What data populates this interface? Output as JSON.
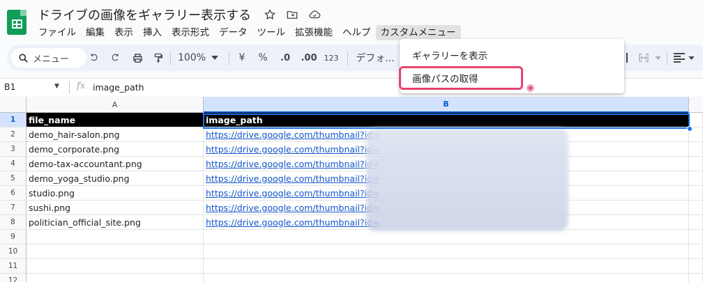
{
  "document": {
    "title": "ドライブの画像をギャラリー表示する"
  },
  "menu": {
    "items": [
      "ファイル",
      "編集",
      "表示",
      "挿入",
      "表示形式",
      "データ",
      "ツール",
      "拡張機能",
      "ヘルプ",
      "カスタムメニュー"
    ],
    "active_index": 9
  },
  "toolbar": {
    "search_label": "メニュー",
    "zoom": "100%",
    "currency": "¥",
    "percent": "%",
    "decimal_decrease": ".0",
    "decimal_increase": ".00",
    "number_format": "123",
    "font": "デフォ..."
  },
  "formula_bar": {
    "cell_ref": "B1",
    "fx": "fx",
    "value": "image_path"
  },
  "grid": {
    "columns": [
      "A",
      "B"
    ],
    "rows": [
      {
        "num": "1",
        "a": "file_name",
        "b": "image_path"
      },
      {
        "num": "2",
        "a": "demo_hair-salon.png",
        "b": "https://drive.google.com/thumbnail?id="
      },
      {
        "num": "3",
        "a": "demo_corporate.png",
        "b": "https://drive.google.com/thumbnail?id="
      },
      {
        "num": "4",
        "a": "demo-tax-accountant.png",
        "b": "https://drive.google.com/thumbnail?id="
      },
      {
        "num": "5",
        "a": "demo_yoga_studio.png",
        "b": "https://drive.google.com/thumbnail?id="
      },
      {
        "num": "6",
        "a": "studio.png",
        "b": "https://drive.google.com/thumbnail?id="
      },
      {
        "num": "7",
        "a": "sushi.png",
        "b": "https://drive.google.com/thumbnail?id="
      },
      {
        "num": "8",
        "a": "politician_official_site.png",
        "b": "https://drive.google.com/thumbnail?id="
      },
      {
        "num": "9",
        "a": "",
        "b": ""
      },
      {
        "num": "10",
        "a": "",
        "b": ""
      },
      {
        "num": "11",
        "a": "",
        "b": ""
      },
      {
        "num": "12",
        "a": "",
        "b": ""
      }
    ]
  },
  "custom_menu": {
    "items": [
      "ギャラリーを表示",
      "画像パスの取得"
    ],
    "highlighted_index": 1,
    "highlight_color": "#e8436f"
  },
  "colors": {
    "logo": "#0f9d58",
    "selection": "#1a73e8",
    "link": "#1155cc",
    "header_fill": "#000000"
  }
}
